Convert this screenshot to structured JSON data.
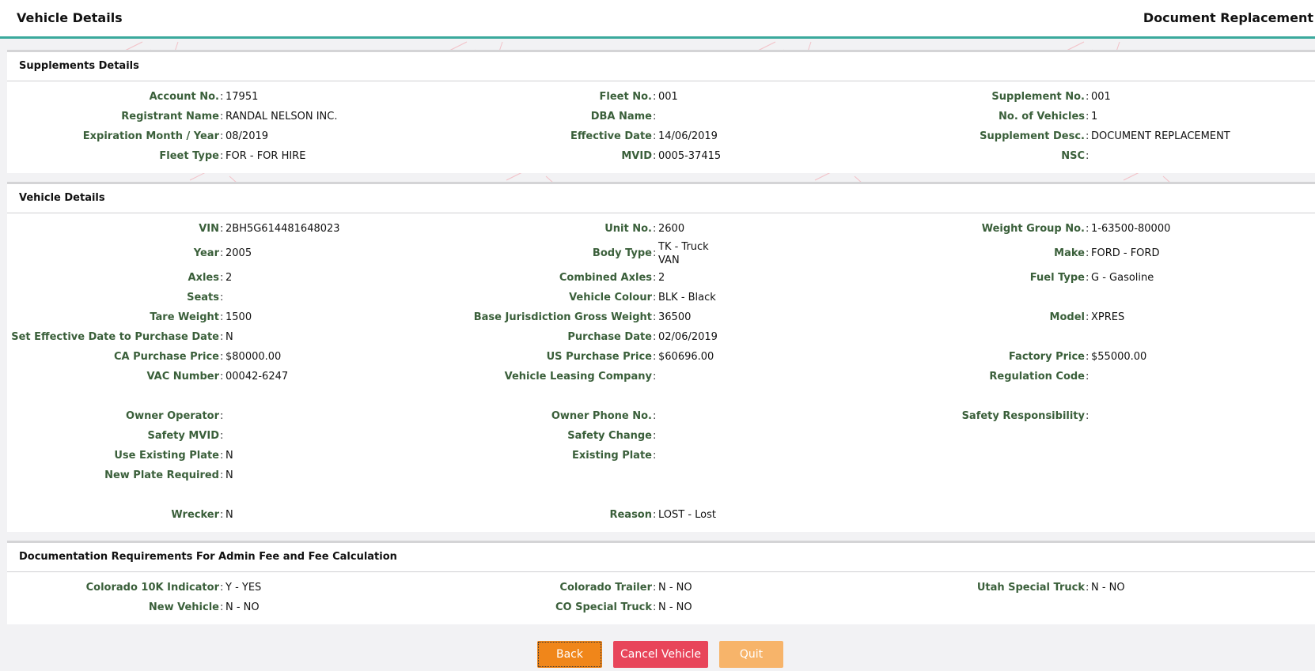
{
  "header": {
    "title": "Vehicle Details",
    "right_title": "Document Replacement"
  },
  "supplements": {
    "title": "Supplements Details",
    "col1": [
      {
        "label": "Account No.",
        "value": "17951"
      },
      {
        "label": "Registrant Name",
        "value": "RANDAL NELSON INC."
      },
      {
        "label": "Expiration Month / Year",
        "value": "08/2019"
      },
      {
        "label": "Fleet Type",
        "value": "FOR - FOR HIRE"
      }
    ],
    "col2": [
      {
        "label": "Fleet No.",
        "value": "001"
      },
      {
        "label": "DBA Name",
        "value": ""
      },
      {
        "label": "Effective Date",
        "value": "14/06/2019"
      },
      {
        "label": "MVID",
        "value": "0005-37415"
      }
    ],
    "col3": [
      {
        "label": "Supplement No.",
        "value": "001"
      },
      {
        "label": "No. of Vehicles",
        "value": "1"
      },
      {
        "label": "Supplement Desc.",
        "value": "DOCUMENT REPLACEMENT"
      },
      {
        "label": "NSC",
        "value": ""
      }
    ]
  },
  "vehicle": {
    "title": "Vehicle Details",
    "col1": [
      {
        "label": "VIN",
        "value": "2BH5G614481648023"
      },
      {
        "label": "Year",
        "value": "2005"
      },
      {
        "label": "Axles",
        "value": "2"
      },
      {
        "label": "Seats",
        "value": ""
      },
      {
        "label": "Tare Weight",
        "value": "1500"
      },
      {
        "label": "Set Effective Date to Purchase Date",
        "value": "N"
      },
      {
        "label": "CA Purchase Price",
        "value": "$80000.00"
      },
      {
        "label": "VAC Number",
        "value": "00042-6247"
      },
      {
        "label": "Owner Operator",
        "value": ""
      },
      {
        "label": "Safety MVID",
        "value": ""
      },
      {
        "label": "Use Existing Plate",
        "value": "N"
      },
      {
        "label": "New Plate Required",
        "value": "N"
      },
      {
        "label": "Wrecker",
        "value": "N"
      }
    ],
    "col2": [
      {
        "label": "Unit No.",
        "value": "2600"
      },
      {
        "label": "Body Type",
        "value": "TK - Truck\nVAN"
      },
      {
        "label": "Combined Axles",
        "value": "2"
      },
      {
        "label": "Vehicle Colour",
        "value": "BLK - Black"
      },
      {
        "label": "Base Jurisdiction Gross Weight",
        "value": "36500"
      },
      {
        "label": "Purchase Date",
        "value": "02/06/2019"
      },
      {
        "label": "US Purchase Price",
        "value": "$60696.00"
      },
      {
        "label": "Vehicle Leasing Company",
        "value": ""
      },
      {
        "label": "Owner Phone No.",
        "value": ""
      },
      {
        "label": "Safety Change",
        "value": ""
      },
      {
        "label": "Existing Plate",
        "value": ""
      },
      {
        "label": "Reason",
        "value": "LOST - Lost"
      }
    ],
    "col3": [
      {
        "label": "Weight Group No.",
        "value": "1-63500-80000"
      },
      {
        "label": "Make",
        "value": "FORD - FORD"
      },
      {
        "label": "Fuel Type",
        "value": "G - Gasoline"
      },
      {
        "label": "Model",
        "value": "XPRES"
      },
      {
        "label": "Factory Price",
        "value": "$55000.00"
      },
      {
        "label": "Regulation Code",
        "value": ""
      },
      {
        "label": "Safety Responsibility",
        "value": ""
      }
    ]
  },
  "documentation": {
    "title": "Documentation Requirements For Admin Fee and Fee Calculation",
    "col1": [
      {
        "label": "Colorado 10K Indicator",
        "value": "Y - YES"
      },
      {
        "label": "New Vehicle",
        "value": "N - NO"
      }
    ],
    "col2": [
      {
        "label": "Colorado Trailer",
        "value": "N - NO"
      },
      {
        "label": "CO Special Truck",
        "value": "N - NO"
      }
    ],
    "col3": [
      {
        "label": "Utah Special Truck",
        "value": "N - NO"
      }
    ]
  },
  "buttons": {
    "back": "Back",
    "cancel_vehicle": "Cancel Vehicle",
    "quit": "Quit"
  },
  "colors": {
    "accent": "#3aa99c",
    "label_green": "#3a5f3a",
    "back_button": "#f0861a",
    "cancel_button": "#e8455a",
    "quit_button": "#f7b46a"
  }
}
